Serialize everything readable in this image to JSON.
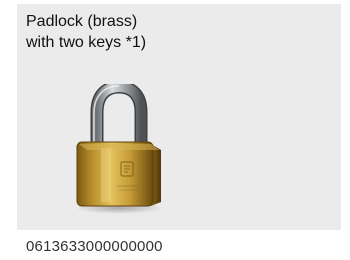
{
  "product": {
    "title": "Padlock (brass)\nwith two keys *1)",
    "code": "0613633000000000",
    "image_name": "padlock-brass-image",
    "background_color": "#ebebeb"
  }
}
